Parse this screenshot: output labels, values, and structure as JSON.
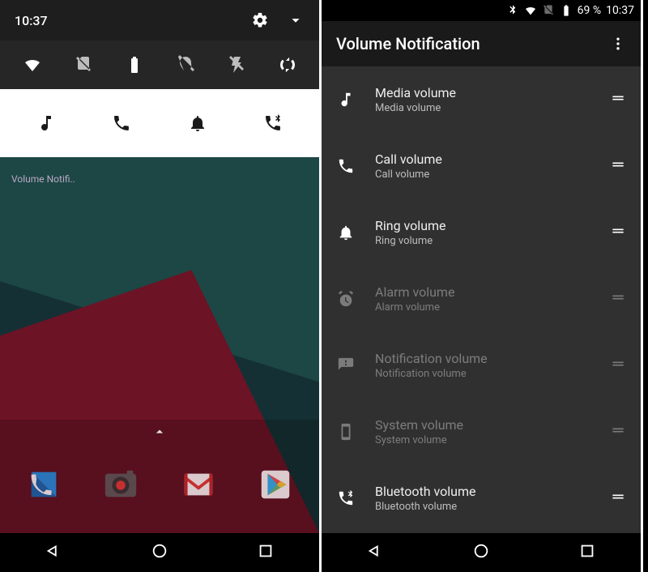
{
  "left": {
    "time": "10:37",
    "homescreen_label": "Volume Notifi..",
    "notif_icons": [
      "music-icon",
      "phone-icon",
      "bell-icon",
      "bluetooth-call-icon"
    ]
  },
  "right": {
    "status": {
      "battery_pct": "69 %",
      "time": "10:37"
    },
    "appbar_title": "Volume Notification",
    "items": [
      {
        "title": "Media volume",
        "sub": "Media volume",
        "icon": "music-icon",
        "dim": false
      },
      {
        "title": "Call volume",
        "sub": "Call volume",
        "icon": "phone-icon",
        "dim": false
      },
      {
        "title": "Ring volume",
        "sub": "Ring volume",
        "icon": "bell-icon",
        "dim": false
      },
      {
        "title": "Alarm volume",
        "sub": "Alarm volume",
        "icon": "alarm-icon",
        "dim": true
      },
      {
        "title": "Notification volume",
        "sub": "Notification volume",
        "icon": "announcement-icon",
        "dim": true
      },
      {
        "title": "System volume",
        "sub": "System volume",
        "icon": "smartphone-icon",
        "dim": true
      },
      {
        "title": "Bluetooth volume",
        "sub": "Bluetooth volume",
        "icon": "bluetooth-call-icon",
        "dim": false
      }
    ]
  }
}
